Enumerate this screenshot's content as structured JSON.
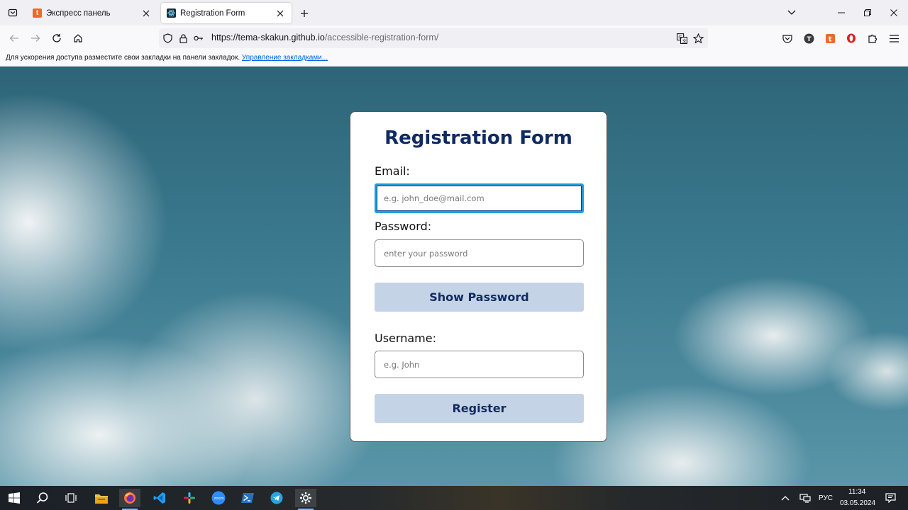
{
  "browser": {
    "tabs": [
      {
        "title": "Экспресс панель",
        "favicon": "t",
        "favicon_color": "#ef6a28",
        "active": false
      },
      {
        "title": "Registration Form",
        "favicon": "react-icon",
        "favicon_color": "#1c2b33",
        "active": true
      }
    ],
    "url": {
      "host": "https://tema-skakun.github.io",
      "path": "/accessible-registration-form/"
    },
    "bookmarks_bar": {
      "message": "Для ускорения доступа разместите свои закладки на панели закладок.",
      "link": "Управление закладками..."
    }
  },
  "form": {
    "title": "Registration Form",
    "email_label": "Email:",
    "email_placeholder": "e.g. john_doe@mail.com",
    "email_value": "",
    "password_label": "Password:",
    "password_placeholder": "enter your password",
    "password_value": "",
    "show_password_button": "Show Password",
    "username_label": "Username:",
    "username_placeholder": "e.g. John",
    "username_value": "",
    "register_button": "Register",
    "colors": {
      "title": "#102a63",
      "button_bg": "#c5d3e6",
      "focus_ring": "#1a9fd8"
    }
  },
  "taskbar": {
    "apps": [
      "windows-start-icon",
      "search-icon",
      "task-view-icon",
      "file-explorer-icon",
      "firefox-icon",
      "vscode-icon",
      "slack-icon",
      "zoom-icon",
      "powershell-icon",
      "telegram-icon",
      "settings-icon"
    ],
    "zoom_label": "zoom",
    "language": "РУС",
    "time": "11:34",
    "date": "03.05.2024"
  }
}
